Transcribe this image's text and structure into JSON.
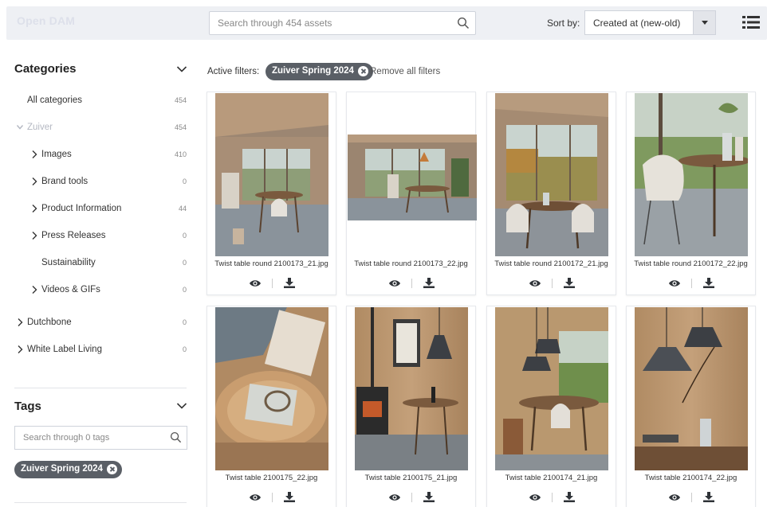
{
  "app": {
    "logo": "Open DAM"
  },
  "search": {
    "placeholder": "Search through 454 assets",
    "value": ""
  },
  "sort": {
    "label": "Sort by:",
    "selected": "Created at (new-old)"
  },
  "categories": {
    "title": "Categories",
    "items": [
      {
        "label": "All categories",
        "count": "454"
      },
      {
        "label": "Zuiver",
        "count": "454"
      },
      {
        "label": "Images",
        "count": "410"
      },
      {
        "label": "Brand tools",
        "count": "0"
      },
      {
        "label": "Product Information",
        "count": "44"
      },
      {
        "label": "Press Releases",
        "count": "0"
      },
      {
        "label": "Sustainability",
        "count": "0"
      },
      {
        "label": "Videos & GIFs",
        "count": "0"
      },
      {
        "label": "Dutchbone",
        "count": "0"
      },
      {
        "label": "White Label Living",
        "count": "0"
      }
    ]
  },
  "tags": {
    "title": "Tags",
    "search_placeholder": "Search through 0 tags",
    "selected_chip": "Zuiver Spring 2024"
  },
  "filters": {
    "label": "Active filters:",
    "chip": "Zuiver Spring 2024",
    "remove_all": "Remove all filters"
  },
  "assets": [
    {
      "name": "Twist table round 2100173_21.jpg"
    },
    {
      "name": "Twist table round 2100173_22.jpg"
    },
    {
      "name": "Twist table round 2100172_21.jpg"
    },
    {
      "name": "Twist table round 2100172_22.jpg"
    },
    {
      "name": "Twist table 2100175_22.jpg"
    },
    {
      "name": "Twist table 2100175_21.jpg"
    },
    {
      "name": "Twist table 2100174_21.jpg"
    },
    {
      "name": "Twist table 2100174_22.jpg"
    }
  ],
  "icons": {
    "search": "search-icon",
    "list_view": "list-view-icon",
    "chevron": "chevron-down-icon",
    "preview": "eye-icon",
    "download": "download-icon",
    "remove": "close-circle-icon"
  }
}
